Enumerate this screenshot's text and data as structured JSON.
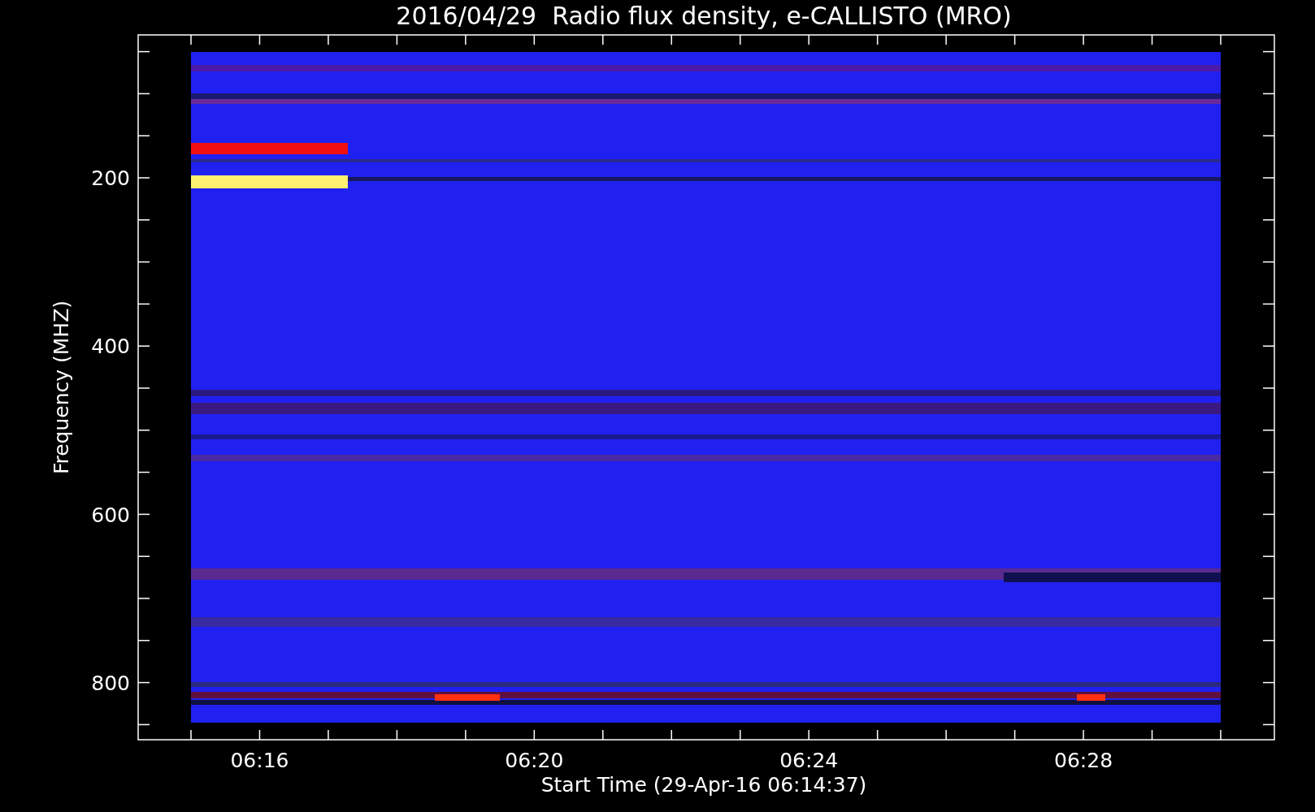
{
  "plot": {
    "title": "2016/04/29  Radio flux density, e-CALLISTO (MRO)",
    "ylabel": "Frequency (MHZ)",
    "xlabel": "Start Time (29-Apr-16 06:14:37)",
    "y_tick_labels": [
      "200",
      "400",
      "600",
      "800"
    ],
    "x_tick_labels": [
      "06:16",
      "06:20",
      "06:24",
      "06:28"
    ]
  }
}
